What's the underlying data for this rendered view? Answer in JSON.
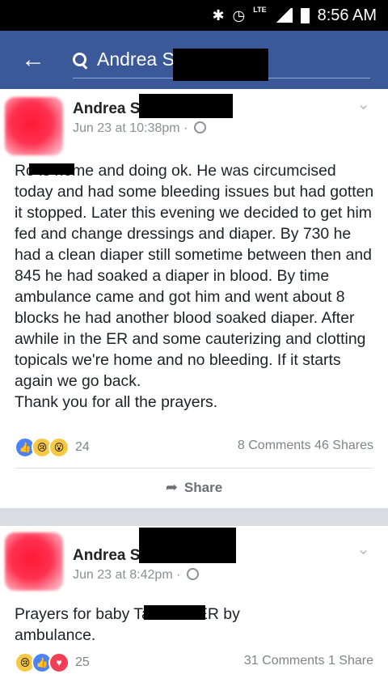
{
  "status_bar": {
    "network": "LTE",
    "time": "8:56 AM"
  },
  "app_bar": {
    "search_query": "Andrea S"
  },
  "posts": [
    {
      "author": "Andrea S",
      "timestamp": "Jun 23 at 10:38pm",
      "text": "Ro is home and doing ok. He was circumcised today and had some bleeding issues but had gotten it stopped. Later this evening we decided to get him fed and change dressings and diaper. By 730 he had a clean diaper still sometime between then and 845 he had soaked a diaper in blood. By time ambulance came and got him and went about 8 blocks he had another blood soaked diaper. After awhile in the ER and some cauterizing and clotting topicals we're home and no bleeding. If it starts again we go back.\nThank you for all the prayers.",
      "reaction_count": "24",
      "comments": "8 Comments",
      "shares": "46 Shares",
      "share_label": "Share"
    },
    {
      "author": "Andrea S",
      "timestamp": "Jun 23 at 8:42pm",
      "text": "Prayers for baby Taken to ER by ambulance.",
      "reaction_count": "25",
      "comments": "31 Comments",
      "shares": "1 Share"
    }
  ],
  "icons": {
    "bluetooth": "bluetooth-icon",
    "alarm": "alarm-icon",
    "signal": "signal-icon",
    "battery": "battery-icon",
    "back": "back-arrow-icon",
    "search": "search-icon",
    "chevron": "chevron-down-icon",
    "globe": "globe-icon",
    "share": "share-arrow-icon"
  },
  "colors": {
    "facebook_blue": "#3b5998",
    "like_blue": "#4c82f7",
    "love_red": "#f33e58"
  }
}
